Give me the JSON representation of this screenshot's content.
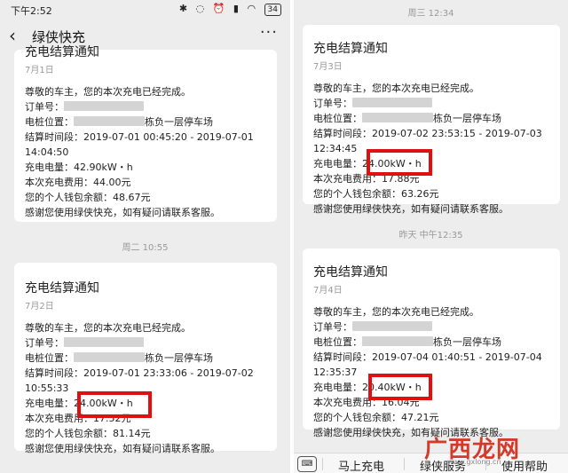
{
  "status_bar": {
    "time": "下午2:52",
    "battery": "34"
  },
  "header": {
    "title": "绿侠快充"
  },
  "labels": {
    "greeting": "尊敬的车主，您的本次充电已经完成。",
    "order": "订单号：",
    "location_prefix": "电桩位置：",
    "location_suffix": "栋负一层停车场",
    "period": "结算时间段：",
    "energy": "充电电量：",
    "fee": "本次充电费用：",
    "balance": "您的个人钱包余额：",
    "thanks": "感谢您使用绿侠快充，如有疑问请联系客服。"
  },
  "messages": [
    {
      "title": "充电结算通知",
      "date": "7月1日",
      "period_start": "2019-07-01 00:45:20 - 2019-07-01",
      "period_end": "14:04:50",
      "energy": "42.90kW・h",
      "fee": "44.00元",
      "balance": "48.67元"
    },
    {
      "title": "充电结算通知",
      "date": "7月2日",
      "period_start": "2019-07-01 23:33:06 - 2019-07-02",
      "period_end": "10:55:33",
      "energy": "24.00kW・h",
      "fee": "17.52元",
      "balance": "81.14元"
    },
    {
      "title": "充电结算通知",
      "date": "7月3日",
      "period_start": "2019-07-02 23:53:15 - 2019-07-03",
      "period_end": "12:34:45",
      "energy": "24.00kW・h",
      "fee": "17.88元",
      "balance": "63.26元"
    },
    {
      "title": "充电结算通知",
      "date": "7月4日",
      "period_start": "2019-07-04 01:40:51 - 2019-07-04",
      "period_end": "12:35:37",
      "energy": "20.40kW・h",
      "fee": "16.04元",
      "balance": "47.21元"
    }
  ],
  "timestamps": {
    "left_mid": "周二 10:55",
    "right_top": "周三 12:34",
    "right_mid": "昨天 中午12:35"
  },
  "menu": {
    "item1": "马上充电",
    "item2": "绿侠服务",
    "item3": "使用帮助"
  },
  "watermark": {
    "brand": "广西龙网",
    "url": "www.gxlong.cn"
  },
  "colors": {
    "highlight": "#e01010",
    "background": "#ededed"
  }
}
